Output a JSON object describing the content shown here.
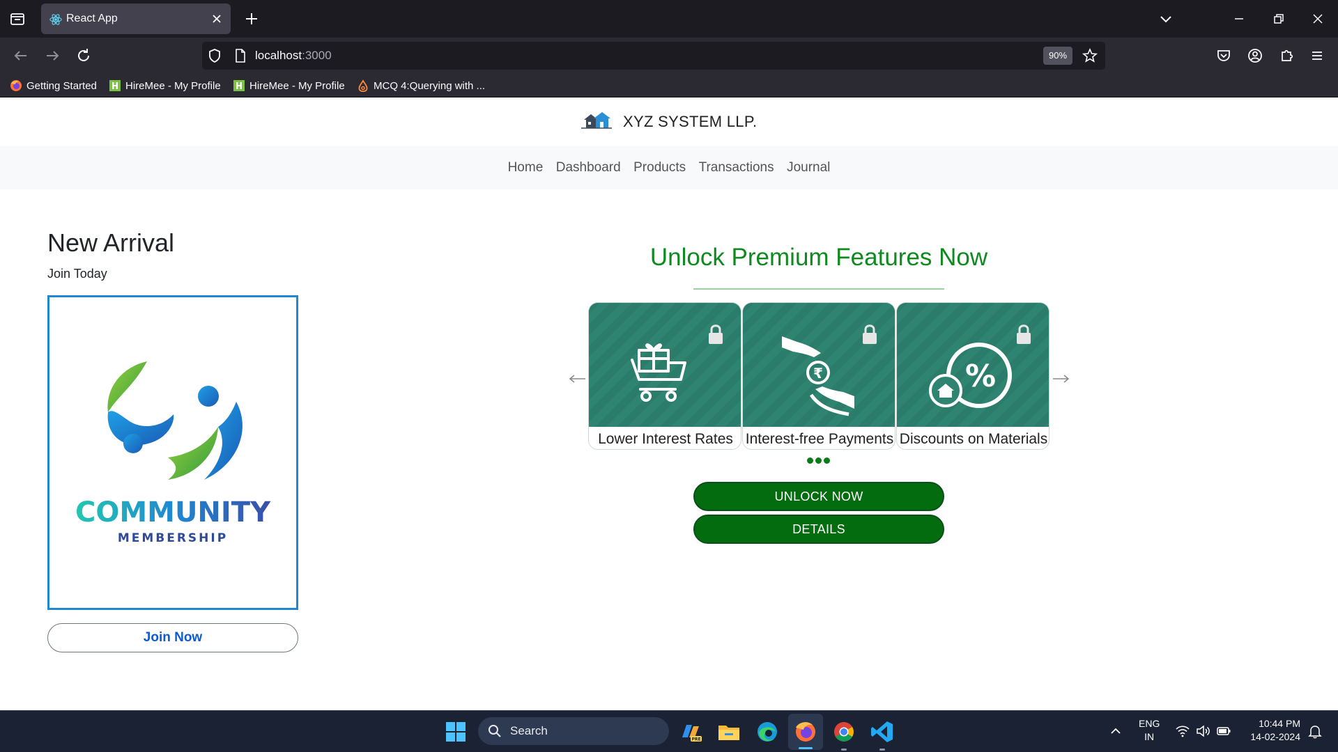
{
  "browser": {
    "tab_title": "React App",
    "url_host": "localhost",
    "url_port": ":3000",
    "zoom": "90%",
    "bookmarks": [
      {
        "label": "Getting Started",
        "icon": "firefox-icon"
      },
      {
        "label": "HireMee - My Profile",
        "icon": "hiremee-icon"
      },
      {
        "label": "HireMee - My Profile",
        "icon": "hiremee-icon"
      },
      {
        "label": "MCQ 4:Querying with ...",
        "icon": "mcq-icon"
      }
    ]
  },
  "site": {
    "brand": "XYZ SYSTEM LLP.",
    "nav": [
      "Home",
      "Dashboard",
      "Products",
      "Transactions",
      "Journal"
    ]
  },
  "left": {
    "heading": "New Arrival",
    "subheading": "Join Today",
    "card_title": "COMMUNITY",
    "card_subtitle": "MEMBERSHIP",
    "join_button": "Join Now"
  },
  "promo": {
    "title": "Unlock Premium Features Now",
    "features": [
      {
        "label": "Lower Interest Rates",
        "icon": "gift-cart-icon"
      },
      {
        "label": "Interest-free Payments",
        "icon": "rupee-hands-icon"
      },
      {
        "label": "Discounts on Materials",
        "icon": "percent-discount-icon"
      }
    ],
    "unlock_button": "UNLOCK NOW",
    "details_button": "DETAILS",
    "colors": {
      "accent": "#0e8a1f",
      "button": "#036c0f",
      "tile": "#2e8471",
      "card_border": "#1e88d2"
    }
  },
  "taskbar": {
    "search_placeholder": "Search",
    "lang_line1": "ENG",
    "lang_line2": "IN",
    "time": "10:44 PM",
    "date": "14-02-2024"
  }
}
